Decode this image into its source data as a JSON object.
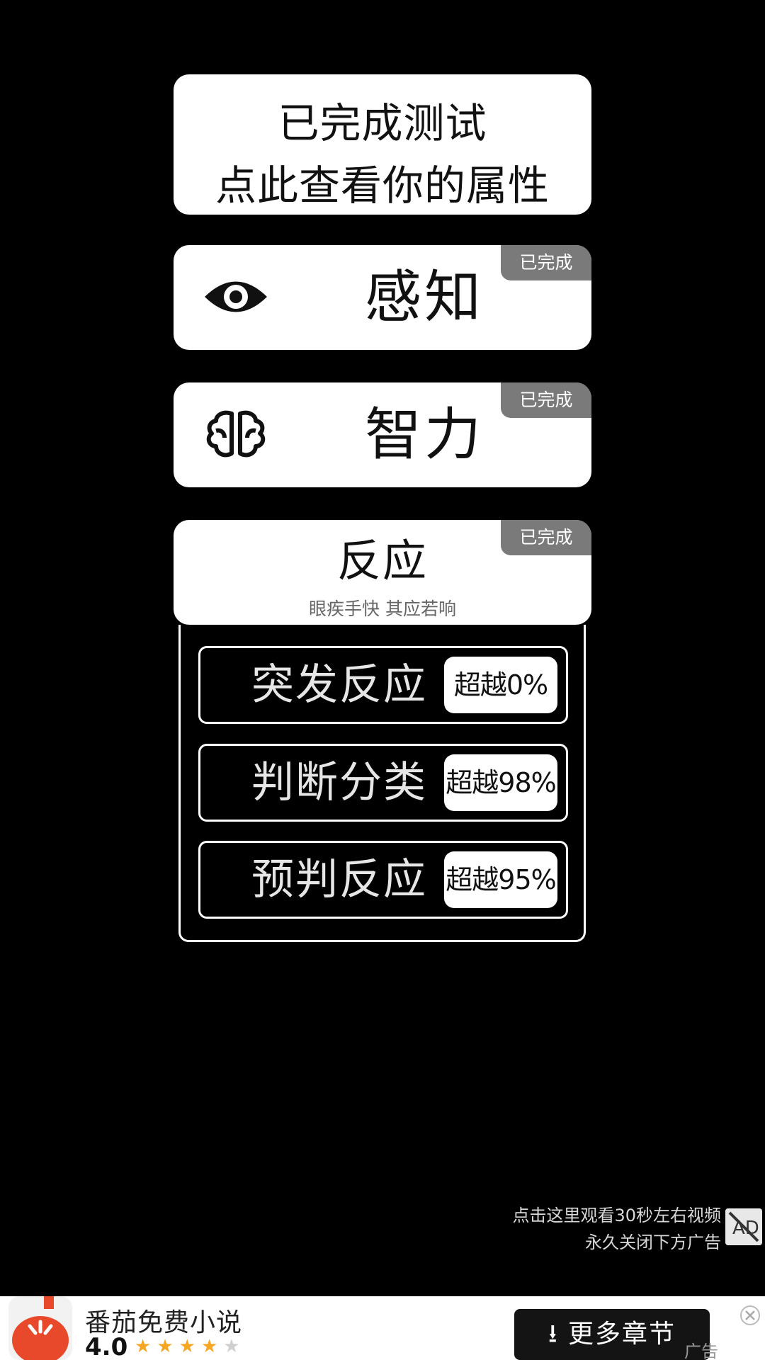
{
  "summary": {
    "line1": "已完成测试",
    "line2": "点此查看你的属性"
  },
  "categories": [
    {
      "label": "感知",
      "badge": "已完成",
      "icon": "eye-icon"
    },
    {
      "label": "智力",
      "badge": "已完成",
      "icon": "brain-icon"
    },
    {
      "label": "反应",
      "badge": "已完成",
      "subtitle": "眼疾手快 其应若响"
    }
  ],
  "reaction_tests": [
    {
      "label": "突发反应",
      "score": "超越0%"
    },
    {
      "label": "判断分类",
      "score": "超越98%"
    },
    {
      "label": "预判反应",
      "score": "超越95%"
    }
  ],
  "ad_hint": {
    "line1": "点击这里观看30秒左右视频",
    "line2": "永久关闭下方广告",
    "icon": "no-ad-icon"
  },
  "banner": {
    "app_name": "番茄免费小说",
    "rating": "4.0",
    "stars_filled": 4,
    "stars_total": 5,
    "button_label": "更多章节",
    "ad_tag": "广告"
  },
  "colors": {
    "background": "#000000",
    "card": "#ffffff",
    "badge": "#7a7a7a",
    "star": "#f5a623",
    "logo": "#e8492a"
  }
}
